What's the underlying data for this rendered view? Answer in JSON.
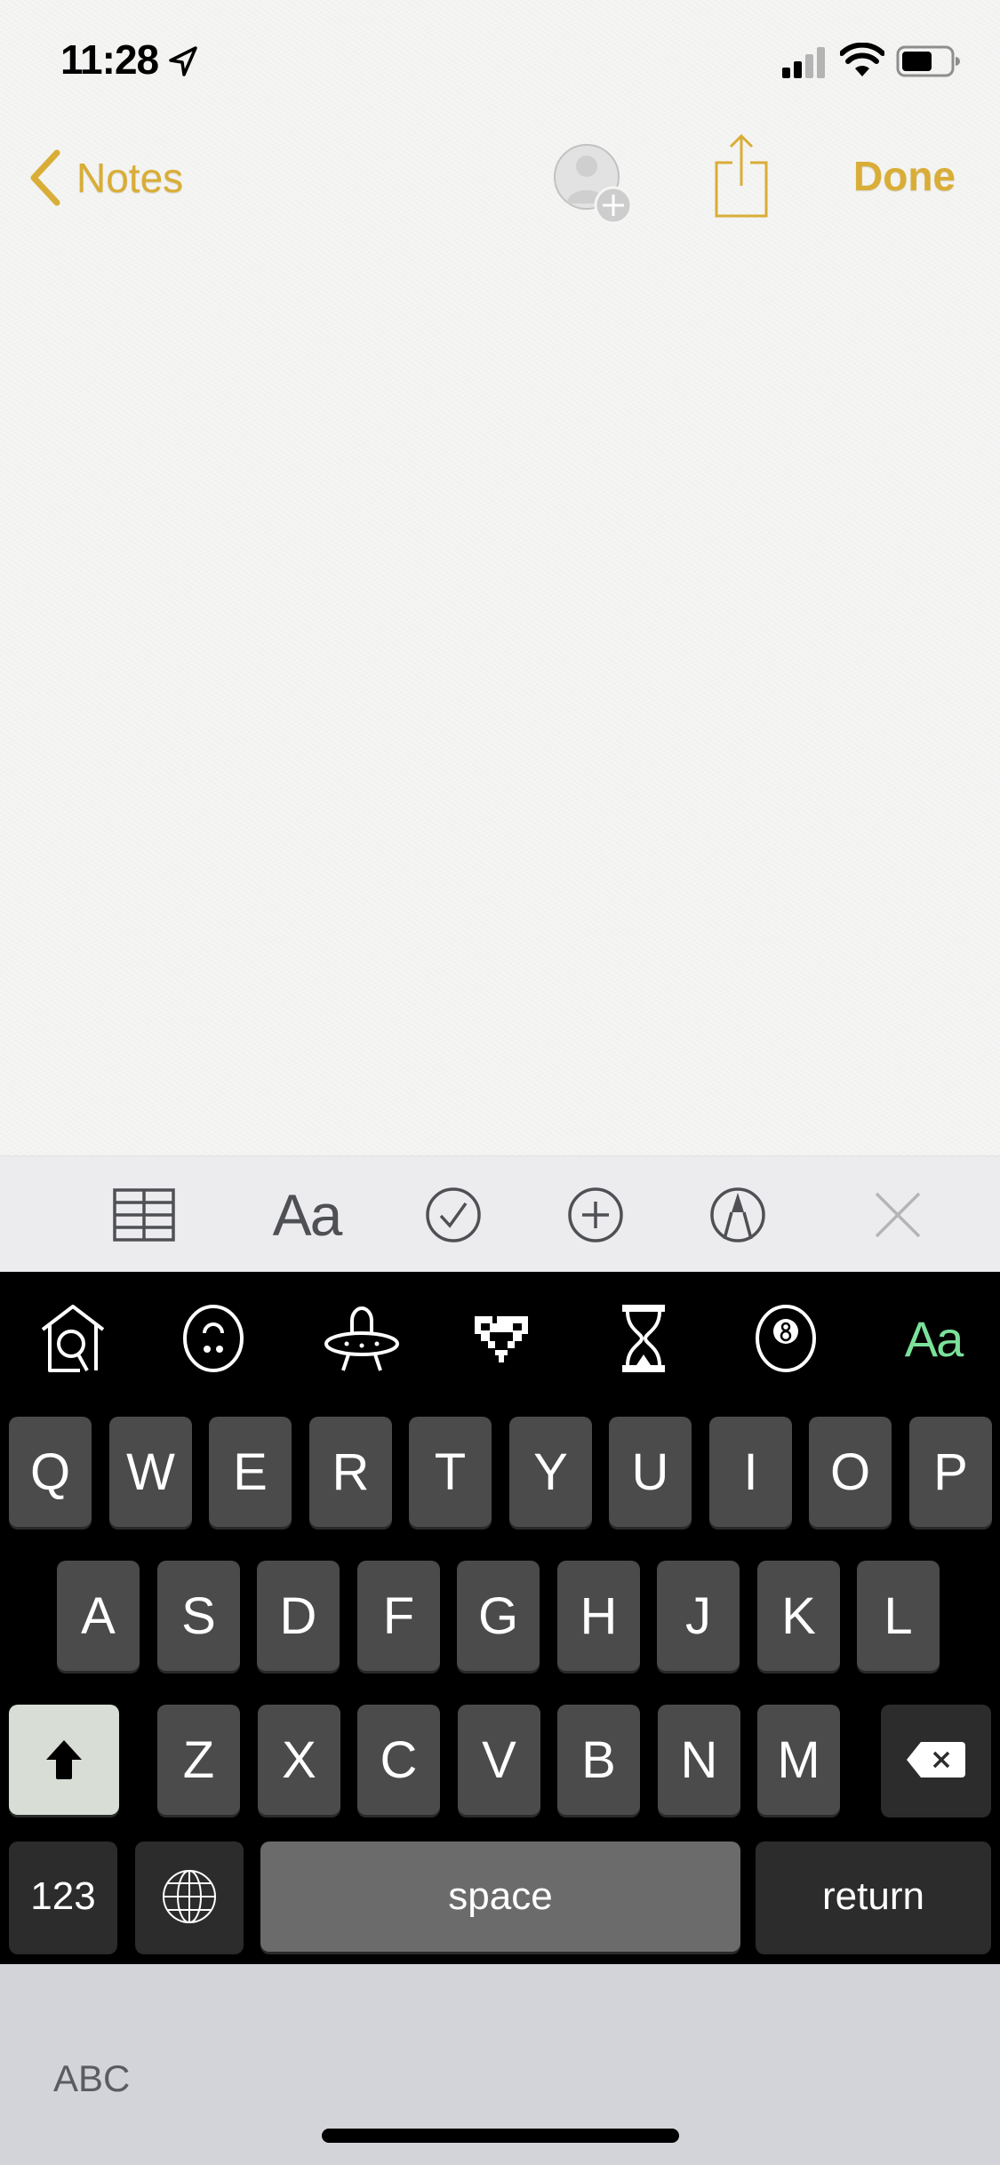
{
  "status_bar": {
    "time": "11:28",
    "location_icon": "location-arrow-icon",
    "signal_icon": "cellular-signal-icon",
    "wifi_icon": "wifi-icon",
    "battery_icon": "battery-icon"
  },
  "nav": {
    "back_label": "Notes",
    "collaborate_icon": "add-person-icon",
    "share_icon": "share-icon",
    "done_label": "Done"
  },
  "note": {
    "content": ""
  },
  "format_toolbar": {
    "items": [
      {
        "name": "table",
        "icon": "table-icon"
      },
      {
        "name": "text-style",
        "label": "Aa"
      },
      {
        "name": "checklist",
        "icon": "checkmark-circle-icon"
      },
      {
        "name": "add-attachment",
        "icon": "plus-circle-icon"
      },
      {
        "name": "markup",
        "icon": "pen-tip-circle-icon"
      },
      {
        "name": "close",
        "icon": "close-icon"
      }
    ]
  },
  "keyboard": {
    "strip_items": [
      {
        "icon": "house-search-icon"
      },
      {
        "icon": "face-icon"
      },
      {
        "icon": "ufo-icon"
      },
      {
        "icon": "pixel-heart-icon"
      },
      {
        "icon": "hourglass-icon"
      },
      {
        "icon": "eight-ball-icon"
      },
      {
        "label": "Aa"
      }
    ],
    "accent_color": "#7be09a",
    "row1": [
      "Q",
      "W",
      "E",
      "R",
      "T",
      "Y",
      "U",
      "I",
      "O",
      "P"
    ],
    "row2": [
      "A",
      "S",
      "D",
      "F",
      "G",
      "H",
      "J",
      "K",
      "L"
    ],
    "row3": [
      "Z",
      "X",
      "C",
      "V",
      "B",
      "N",
      "M"
    ],
    "numbers_label": "123",
    "space_label": "space",
    "return_label": "return"
  },
  "bottom": {
    "abc_label": "ABC"
  },
  "colors": {
    "accent": "#d9ad36",
    "key_bg": "#4b4b4b",
    "keyboard_bg": "#000000"
  }
}
